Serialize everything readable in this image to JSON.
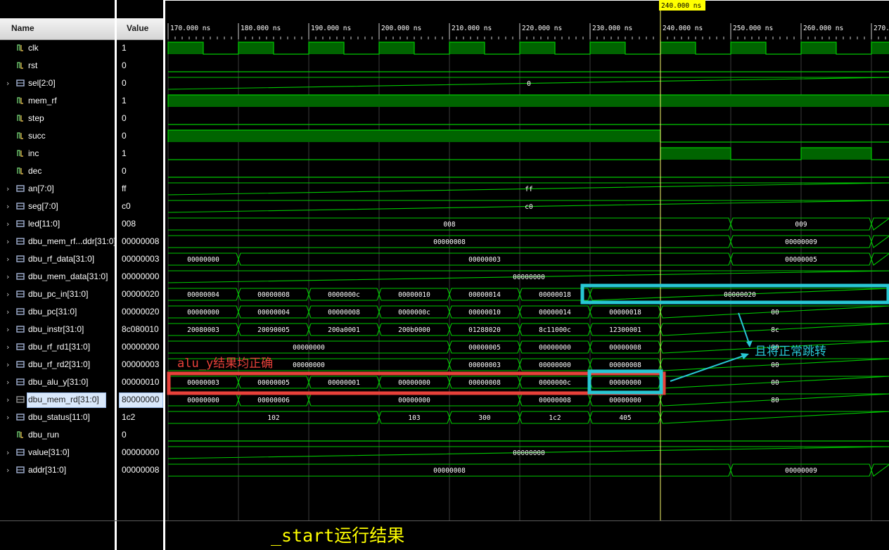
{
  "panel": {
    "name_header": "Name",
    "value_header": "Value"
  },
  "cursor": {
    "label": "240.000 ns"
  },
  "timeline": {
    "ticks": [
      "170.000 ns",
      "180.000 ns",
      "190.000 ns",
      "200.000 ns",
      "210.000 ns",
      "220.000 ns",
      "230.000 ns",
      "240.000 ns",
      "250.000 ns",
      "260.000 ns",
      "270."
    ]
  },
  "signals": [
    {
      "name": "clk",
      "value": "1",
      "type": "bit",
      "expandable": false
    },
    {
      "name": "rst",
      "value": "0",
      "type": "bit",
      "expandable": false
    },
    {
      "name": "sel[2:0]",
      "value": "0",
      "type": "bus",
      "expandable": true
    },
    {
      "name": "mem_rf",
      "value": "1",
      "type": "bit",
      "expandable": false
    },
    {
      "name": "step",
      "value": "0",
      "type": "bit",
      "expandable": false
    },
    {
      "name": "succ",
      "value": "0",
      "type": "bit",
      "expandable": false
    },
    {
      "name": "inc",
      "value": "1",
      "type": "bit",
      "expandable": false
    },
    {
      "name": "dec",
      "value": "0",
      "type": "bit",
      "expandable": false
    },
    {
      "name": "an[7:0]",
      "value": "ff",
      "type": "bus",
      "expandable": true
    },
    {
      "name": "seg[7:0]",
      "value": "c0",
      "type": "bus",
      "expandable": true
    },
    {
      "name": "led[11:0]",
      "value": "008",
      "type": "bus",
      "expandable": true
    },
    {
      "name": "dbu_mem_rf...ddr[31:0]",
      "value": "00000008",
      "type": "bus",
      "expandable": true
    },
    {
      "name": "dbu_rf_data[31:0]",
      "value": "00000003",
      "type": "bus",
      "expandable": true
    },
    {
      "name": "dbu_mem_data[31:0]",
      "value": "00000000",
      "type": "bus",
      "expandable": true
    },
    {
      "name": "dbu_pc_in[31:0]",
      "value": "00000020",
      "type": "bus",
      "expandable": true
    },
    {
      "name": "dbu_pc[31:0]",
      "value": "00000020",
      "type": "bus",
      "expandable": true
    },
    {
      "name": "dbu_instr[31:0]",
      "value": "8c080010",
      "type": "bus",
      "expandable": true
    },
    {
      "name": "dbu_rf_rd1[31:0]",
      "value": "00000000",
      "type": "bus",
      "expandable": true
    },
    {
      "name": "dbu_rf_rd2[31:0]",
      "value": "00000003",
      "type": "bus",
      "expandable": true
    },
    {
      "name": "dbu_alu_y[31:0]",
      "value": "00000010",
      "type": "bus",
      "expandable": true
    },
    {
      "name": "dbu_mem_rd[31:0]",
      "value": "80000000",
      "type": "bus",
      "expandable": true,
      "selected": true
    },
    {
      "name": "dbu_status[11:0]",
      "value": "1c2",
      "type": "bus",
      "expandable": true
    },
    {
      "name": "dbu_run",
      "value": "0",
      "type": "bit",
      "expandable": false
    },
    {
      "name": "value[31:0]",
      "value": "00000000",
      "type": "bus",
      "expandable": true
    },
    {
      "name": "addr[31:0]",
      "value": "00000008",
      "type": "bus",
      "expandable": true
    }
  ],
  "waveforms": {
    "clk": {
      "highs": [
        [
          170,
          175
        ],
        [
          180,
          185
        ],
        [
          190,
          195
        ],
        [
          200,
          205
        ],
        [
          210,
          215
        ],
        [
          220,
          225
        ],
        [
          230,
          235
        ],
        [
          240,
          245
        ],
        [
          250,
          255
        ],
        [
          260,
          265
        ],
        [
          270,
          272.6
        ]
      ]
    },
    "rst": {
      "highs": []
    },
    "mem_rf": {
      "highs": [
        [
          170,
          272.6
        ]
      ]
    },
    "step": {
      "highs": []
    },
    "succ": {
      "highs": [
        [
          170,
          240
        ]
      ]
    },
    "inc": {
      "highs": [
        [
          240,
          250
        ],
        [
          260,
          270
        ]
      ]
    },
    "dec": {
      "highs": []
    },
    "dbu_run": {
      "highs": []
    },
    "sel[2:0]": {
      "segments": [
        {
          "from": 170,
          "to": 272.6,
          "label": "0"
        }
      ]
    },
    "an[7:0]": {
      "segments": [
        {
          "from": 170,
          "to": 272.6,
          "label": "ff"
        }
      ]
    },
    "seg[7:0]": {
      "segments": [
        {
          "from": 170,
          "to": 272.6,
          "label": "c0"
        }
      ]
    },
    "led[11:0]": {
      "segments": [
        {
          "from": 170,
          "to": 250,
          "label": "008"
        },
        {
          "from": 250,
          "to": 270,
          "label": "009"
        },
        {
          "from": 270,
          "to": 272.6,
          "label": ""
        }
      ]
    },
    "dbu_mem_rf...ddr[31:0]": {
      "segments": [
        {
          "from": 170,
          "to": 250,
          "label": "00000008"
        },
        {
          "from": 250,
          "to": 270,
          "label": "00000009"
        },
        {
          "from": 270,
          "to": 272.6,
          "label": ""
        }
      ]
    },
    "dbu_rf_data[31:0]": {
      "segments": [
        {
          "from": 170,
          "to": 180,
          "label": "00000000"
        },
        {
          "from": 180,
          "to": 250,
          "label": "00000003"
        },
        {
          "from": 250,
          "to": 270,
          "label": "00000005"
        },
        {
          "from": 270,
          "to": 272.6,
          "label": ""
        }
      ]
    },
    "dbu_mem_data[31:0]": {
      "segments": [
        {
          "from": 170,
          "to": 272.6,
          "label": "00000000"
        }
      ]
    },
    "dbu_pc_in[31:0]": {
      "segments": [
        {
          "from": 170,
          "to": 180,
          "label": "00000004"
        },
        {
          "from": 180,
          "to": 190,
          "label": "00000008"
        },
        {
          "from": 190,
          "to": 200,
          "label": "0000000c"
        },
        {
          "from": 200,
          "to": 210,
          "label": "00000010"
        },
        {
          "from": 210,
          "to": 220,
          "label": "00000014"
        },
        {
          "from": 220,
          "to": 230,
          "label": "00000018"
        },
        {
          "from": 230,
          "to": 272.6,
          "label": "00000020"
        }
      ]
    },
    "dbu_pc[31:0]": {
      "segments": [
        {
          "from": 170,
          "to": 180,
          "label": "00000000"
        },
        {
          "from": 180,
          "to": 190,
          "label": "00000004"
        },
        {
          "from": 190,
          "to": 200,
          "label": "00000008"
        },
        {
          "from": 200,
          "to": 210,
          "label": "0000000c"
        },
        {
          "from": 210,
          "to": 220,
          "label": "00000010"
        },
        {
          "from": 220,
          "to": 230,
          "label": "00000014"
        },
        {
          "from": 230,
          "to": 240,
          "label": "00000018"
        },
        {
          "from": 240,
          "to": 272.6,
          "label": "00"
        }
      ]
    },
    "dbu_instr[31:0]": {
      "segments": [
        {
          "from": 170,
          "to": 180,
          "label": "20080003"
        },
        {
          "from": 180,
          "to": 190,
          "label": "20090005"
        },
        {
          "from": 190,
          "to": 200,
          "label": "200a0001"
        },
        {
          "from": 200,
          "to": 210,
          "label": "200b0000"
        },
        {
          "from": 210,
          "to": 220,
          "label": "01288020"
        },
        {
          "from": 220,
          "to": 230,
          "label": "8c11000c"
        },
        {
          "from": 230,
          "to": 240,
          "label": "12300001"
        },
        {
          "from": 240,
          "to": 272.6,
          "label": "8c"
        }
      ]
    },
    "dbu_rf_rd1[31:0]": {
      "segments": [
        {
          "from": 170,
          "to": 210,
          "label": "00000000"
        },
        {
          "from": 210,
          "to": 220,
          "label": "00000005"
        },
        {
          "from": 220,
          "to": 230,
          "label": "00000000"
        },
        {
          "from": 230,
          "to": 240,
          "label": "00000008"
        },
        {
          "from": 240,
          "to": 272.6,
          "label": "00"
        }
      ]
    },
    "dbu_rf_rd2[31:0]": {
      "segments": [
        {
          "from": 170,
          "to": 210,
          "label": "00000000"
        },
        {
          "from": 210,
          "to": 220,
          "label": "00000003"
        },
        {
          "from": 220,
          "to": 230,
          "label": "00000000"
        },
        {
          "from": 230,
          "to": 240,
          "label": "00000008"
        },
        {
          "from": 240,
          "to": 272.6,
          "label": "00"
        }
      ]
    },
    "dbu_alu_y[31:0]": {
      "segments": [
        {
          "from": 170,
          "to": 180,
          "label": "00000003"
        },
        {
          "from": 180,
          "to": 190,
          "label": "00000005"
        },
        {
          "from": 190,
          "to": 200,
          "label": "00000001"
        },
        {
          "from": 200,
          "to": 210,
          "label": "00000000"
        },
        {
          "from": 210,
          "to": 220,
          "label": "00000008"
        },
        {
          "from": 220,
          "to": 230,
          "label": "0000000c"
        },
        {
          "from": 230,
          "to": 240,
          "label": "00000000"
        },
        {
          "from": 240,
          "to": 272.6,
          "label": "00"
        }
      ]
    },
    "dbu_mem_rd[31:0]": {
      "segments": [
        {
          "from": 170,
          "to": 180,
          "label": "00000000"
        },
        {
          "from": 180,
          "to": 190,
          "label": "00000006"
        },
        {
          "from": 190,
          "to": 220,
          "label": "00000000"
        },
        {
          "from": 220,
          "to": 230,
          "label": "00000008"
        },
        {
          "from": 230,
          "to": 240,
          "label": "00000000"
        },
        {
          "from": 240,
          "to": 272.6,
          "label": "80"
        }
      ]
    },
    "dbu_status[11:0]": {
      "segments": [
        {
          "from": 170,
          "to": 200,
          "label": "102"
        },
        {
          "from": 200,
          "to": 210,
          "label": "103"
        },
        {
          "from": 210,
          "to": 220,
          "label": "300"
        },
        {
          "from": 220,
          "to": 230,
          "label": "1c2"
        },
        {
          "from": 230,
          "to": 240,
          "label": "405"
        },
        {
          "from": 240,
          "to": 272.6,
          "label": ""
        }
      ]
    },
    "value[31:0]": {
      "segments": [
        {
          "from": 170,
          "to": 272.6,
          "label": "00000000"
        }
      ]
    },
    "addr[31:0]": {
      "segments": [
        {
          "from": 170,
          "to": 250,
          "label": "00000008"
        },
        {
          "from": 250,
          "to": 270,
          "label": "00000009"
        },
        {
          "from": 270,
          "to": 272.6,
          "label": ""
        }
      ]
    }
  },
  "annotations": {
    "alu_note": "alu_y结果均正确",
    "jump_note": "且将正常跳转",
    "caption": "_start运行结果",
    "red_color": "#e8413a",
    "cyan_color": "#27c7d4"
  },
  "colors": {
    "wave_green": "#00c800",
    "wave_fill": "#006400",
    "cursor": "#f5f56a",
    "grid": "#3a3a3a"
  }
}
